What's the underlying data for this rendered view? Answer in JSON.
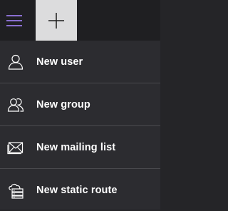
{
  "colors": {
    "accent": "#8a6fd1",
    "topbar_bg": "#1f1f22",
    "menu_bg": "#2c2c30",
    "plus_bg": "#dcdcdd",
    "divider": "#4a4a4e",
    "text": "#ffffff"
  },
  "toolbar": {
    "menu_icon": "hamburger-icon",
    "add_icon": "plus-icon"
  },
  "menu": {
    "items": [
      {
        "label": "New user",
        "icon": "user-icon"
      },
      {
        "label": "New group",
        "icon": "group-icon"
      },
      {
        "label": "New mailing list",
        "icon": "mail-icon"
      },
      {
        "label": "New static route",
        "icon": "static-route-icon"
      }
    ]
  }
}
